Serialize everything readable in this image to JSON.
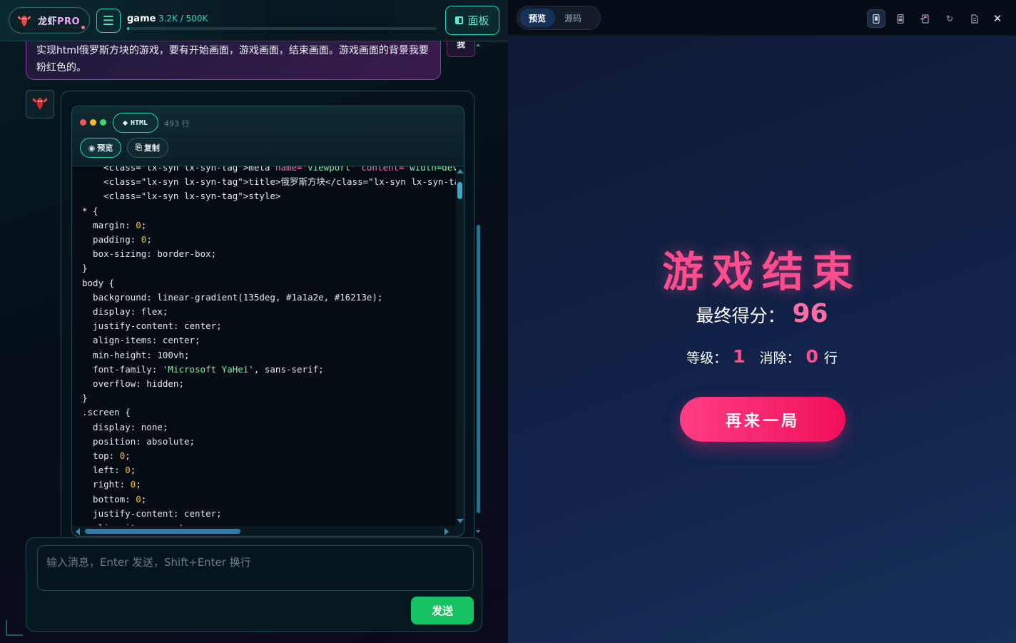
{
  "header": {
    "brand_name": "龙虾",
    "brand_suffix": "PRO",
    "session_title": "game",
    "token_usage": "3.2K / 500K",
    "token_fraction": 0.0064,
    "panel_label": "面板"
  },
  "chat": {
    "user_message": "实现html俄罗斯方块的游戏，要有开始画面，游戏画面，结束画面。游戏画面的背景我要粉红色的。",
    "user_avatar_label": "我",
    "code_block": {
      "language": "HTML",
      "line_count": "493 行",
      "preview_label": "预览",
      "copy_label": "复制",
      "lines": [
        [
          {
            "t": "    <class=\"lx-syn lx-syn-tag\">meta ",
            "c": "tag"
          },
          {
            "t": "name=",
            "c": "attr"
          },
          {
            "t": "\"viewport\" ",
            "c": "str"
          },
          {
            "t": "content=",
            "c": "attr"
          },
          {
            "t": "\"width=devi",
            "c": "str"
          }
        ],
        [
          {
            "t": "    <class=\"lx-syn lx-syn-tag\">title>俄罗斯方块</class=\"lx-syn lx-syn-tag",
            "c": "tag"
          }
        ],
        [
          {
            "t": "    <class=\"lx-syn lx-syn-tag\">style>",
            "c": "tag"
          }
        ],
        [
          {
            "t": "* {",
            "c": "kw"
          }
        ],
        [
          {
            "t": "  margin: ",
            "c": "kw"
          },
          {
            "t": "0",
            "c": "num"
          },
          {
            "t": ";",
            "c": "kw"
          }
        ],
        [
          {
            "t": "  padding: ",
            "c": "kw"
          },
          {
            "t": "0",
            "c": "num"
          },
          {
            "t": ";",
            "c": "kw"
          }
        ],
        [
          {
            "t": "  box-sizing: border-box;",
            "c": "kw"
          }
        ],
        [
          {
            "t": "}",
            "c": "kw"
          }
        ],
        [
          {
            "t": "body {",
            "c": "kw"
          }
        ],
        [
          {
            "t": "  background: linear-gradient(135deg, #1a1a2e, #16213e);",
            "c": "kw"
          }
        ],
        [
          {
            "t": "  display: flex;",
            "c": "kw"
          }
        ],
        [
          {
            "t": "  justify-content: center;",
            "c": "kw"
          }
        ],
        [
          {
            "t": "  align-items: center;",
            "c": "kw"
          }
        ],
        [
          {
            "t": "  min-height: 100vh;",
            "c": "kw"
          }
        ],
        [
          {
            "t": "  font-family: ",
            "c": "kw"
          },
          {
            "t": "'Microsoft YaHei'",
            "c": "str"
          },
          {
            "t": ", sans-serif;",
            "c": "kw"
          }
        ],
        [
          {
            "t": "  overflow: hidden;",
            "c": "kw"
          }
        ],
        [
          {
            "t": "}",
            "c": "kw"
          }
        ],
        [
          {
            "t": ".screen {",
            "c": "kw"
          }
        ],
        [
          {
            "t": "  display: none;",
            "c": "kw"
          }
        ],
        [
          {
            "t": "  position: absolute;",
            "c": "kw"
          }
        ],
        [
          {
            "t": "  top: ",
            "c": "kw"
          },
          {
            "t": "0",
            "c": "num"
          },
          {
            "t": ";",
            "c": "kw"
          }
        ],
        [
          {
            "t": "  left: ",
            "c": "kw"
          },
          {
            "t": "0",
            "c": "num"
          },
          {
            "t": ";",
            "c": "kw"
          }
        ],
        [
          {
            "t": "  right: ",
            "c": "kw"
          },
          {
            "t": "0",
            "c": "num"
          },
          {
            "t": ";",
            "c": "kw"
          }
        ],
        [
          {
            "t": "  bottom: ",
            "c": "kw"
          },
          {
            "t": "0",
            "c": "num"
          },
          {
            "t": ";",
            "c": "kw"
          }
        ],
        [
          {
            "t": "  justify-content: center;",
            "c": "kw"
          }
        ],
        [
          {
            "t": "  align-items: center;",
            "c": "kw"
          }
        ]
      ]
    }
  },
  "composer": {
    "placeholder": "输入消息，Enter 发送，Shift+Enter 换行",
    "send_label": "发送"
  },
  "preview_panel": {
    "tabs": [
      {
        "label": "预览",
        "active": true
      },
      {
        "label": "源码",
        "active": false
      }
    ],
    "tool_icons": [
      "mobile-icon",
      "phone-icon",
      "fit-icon",
      "refresh-icon",
      "copy-doc-icon",
      "close-icon"
    ]
  },
  "game_over": {
    "title": "游戏结束",
    "score_label": "最终得分：",
    "score": "96",
    "level_label": "等级：",
    "level": "1",
    "lines_label": "消除：",
    "lines": "0",
    "lines_unit": "行",
    "restart_label": "再来一局"
  },
  "colors": {
    "accent_teal": "#2dd4bf",
    "game_pink": "#ff4d8d",
    "send_green": "#16c262",
    "restart_gradient_start": "#ff3d86",
    "restart_gradient_end": "#f0105a"
  }
}
